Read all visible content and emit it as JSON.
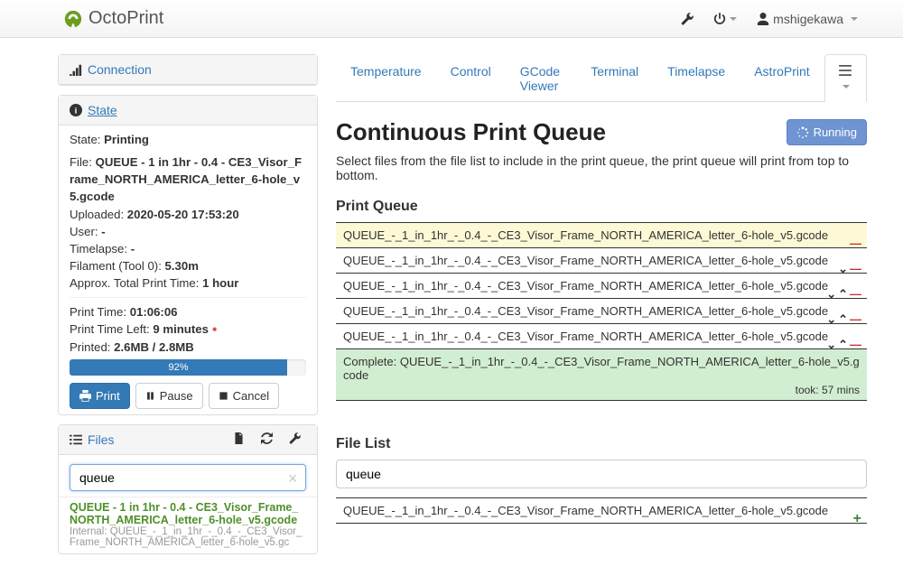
{
  "brand": "OctoPrint",
  "user": "mshigekawa",
  "sidebar": {
    "connection": {
      "title": "Connection"
    },
    "state": {
      "title": "State",
      "state_label": "State:",
      "state_value": "Printing",
      "file_label": "File:",
      "file_value": "QUEUE - 1 in 1hr - 0.4 - CE3_Visor_Frame_NORTH_AMERICA_letter_6-hole_v5.gcode",
      "uploaded_label": "Uploaded:",
      "uploaded_value": "2020-05-20 17:53:20",
      "user_label": "User:",
      "user_value": "-",
      "timelapse_label": "Timelapse:",
      "timelapse_value": "-",
      "filament_label": "Filament (Tool 0):",
      "filament_value": "5.30m",
      "approx_label": "Approx. Total Print Time:",
      "approx_value": "1 hour",
      "pt_label": "Print Time:",
      "pt_value": "01:06:06",
      "ptl_label": "Print Time Left:",
      "ptl_value": "9 minutes",
      "printed_label": "Printed:",
      "printed_value": "2.6MB / 2.8MB",
      "progress_pct": 92,
      "progress_text": "92%",
      "print_btn": "Print",
      "pause_btn": "Pause",
      "cancel_btn": "Cancel"
    },
    "files": {
      "title": "Files",
      "search_value": "queue",
      "entry_name": "QUEUE - 1 in 1hr - 0.4 - CE3_Visor_Frame_NORTH_AMERICA_letter_6-hole_v5.gcode",
      "entry_meta": "Internal: QUEUE_-_1_in_1hr_-_0.4_-_CE3_Visor_Frame_NORTH_AMERICA_letter_6-hole_v5.gc"
    }
  },
  "tabs": [
    "Temperature",
    "Control",
    "GCode Viewer",
    "Terminal",
    "Timelapse",
    "AstroPrint"
  ],
  "cpq": {
    "title": "Continuous Print Queue",
    "status_btn": "Running",
    "desc": "Select files from the file list to include in the print queue, the print queue will print from top to bottom.",
    "queue_heading": "Print Queue",
    "items": [
      {
        "name": "QUEUE_-_1_in_1hr_-_0.4_-_CE3_Visor_Frame_NORTH_AMERICA_letter_6-hole_v5.gcode",
        "state": "current"
      },
      {
        "name": "QUEUE_-_1_in_1hr_-_0.4_-_CE3_Visor_Frame_NORTH_AMERICA_letter_6-hole_v5.gcode",
        "state": "pending"
      },
      {
        "name": "QUEUE_-_1_in_1hr_-_0.4_-_CE3_Visor_Frame_NORTH_AMERICA_letter_6-hole_v5.gcode",
        "state": "pending"
      },
      {
        "name": "QUEUE_-_1_in_1hr_-_0.4_-_CE3_Visor_Frame_NORTH_AMERICA_letter_6-hole_v5.gcode",
        "state": "pending"
      },
      {
        "name": "QUEUE_-_1_in_1hr_-_0.4_-_CE3_Visor_Frame_NORTH_AMERICA_letter_6-hole_v5.gcode",
        "state": "pending"
      },
      {
        "name": "Complete: QUEUE_-_1_in_1hr_-_0.4_-_CE3_Visor_Frame_NORTH_AMERICA_letter_6-hole_v5.gcode",
        "state": "complete",
        "took": "took: 57 mins"
      }
    ],
    "filelist_heading": "File List",
    "filelist_search": "queue",
    "filelist_items": [
      "QUEUE_-_1_in_1hr_-_0.4_-_CE3_Visor_Frame_NORTH_AMERICA_letter_6-hole_v5.gcode"
    ]
  }
}
